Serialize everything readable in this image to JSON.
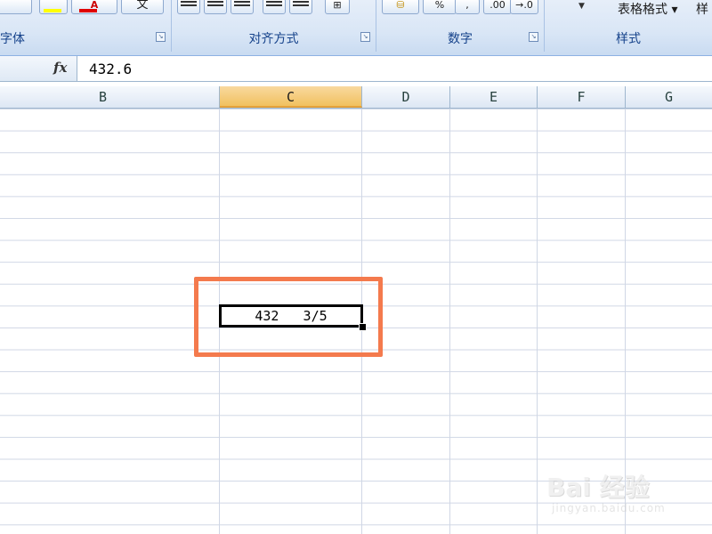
{
  "ribbon": {
    "groups": [
      {
        "label": "字体"
      },
      {
        "label": "对齐方式"
      },
      {
        "label": "数字"
      },
      {
        "label": "样式"
      }
    ],
    "number_buttons": {
      "percent": "%",
      "comma": ",",
      "inc_decimal": ".00",
      "dec_decimal": "→.0"
    },
    "styles": {
      "table_format": "表格格式 ▾",
      "cell_styles": "样"
    }
  },
  "formula_bar": {
    "fx_label": "fx",
    "value": "432.6"
  },
  "columns": [
    "B",
    "C",
    "D",
    "E",
    "F",
    "G"
  ],
  "active_column": "C",
  "active_cell": {
    "display_value": "432   3/5"
  },
  "watermark": {
    "logo": "Bai 经验",
    "url": "jingyan.baidu.com"
  },
  "colors": {
    "highlight": "#f47a4d",
    "ribbon_text": "#15428b",
    "active_header": "#f1c15f"
  }
}
